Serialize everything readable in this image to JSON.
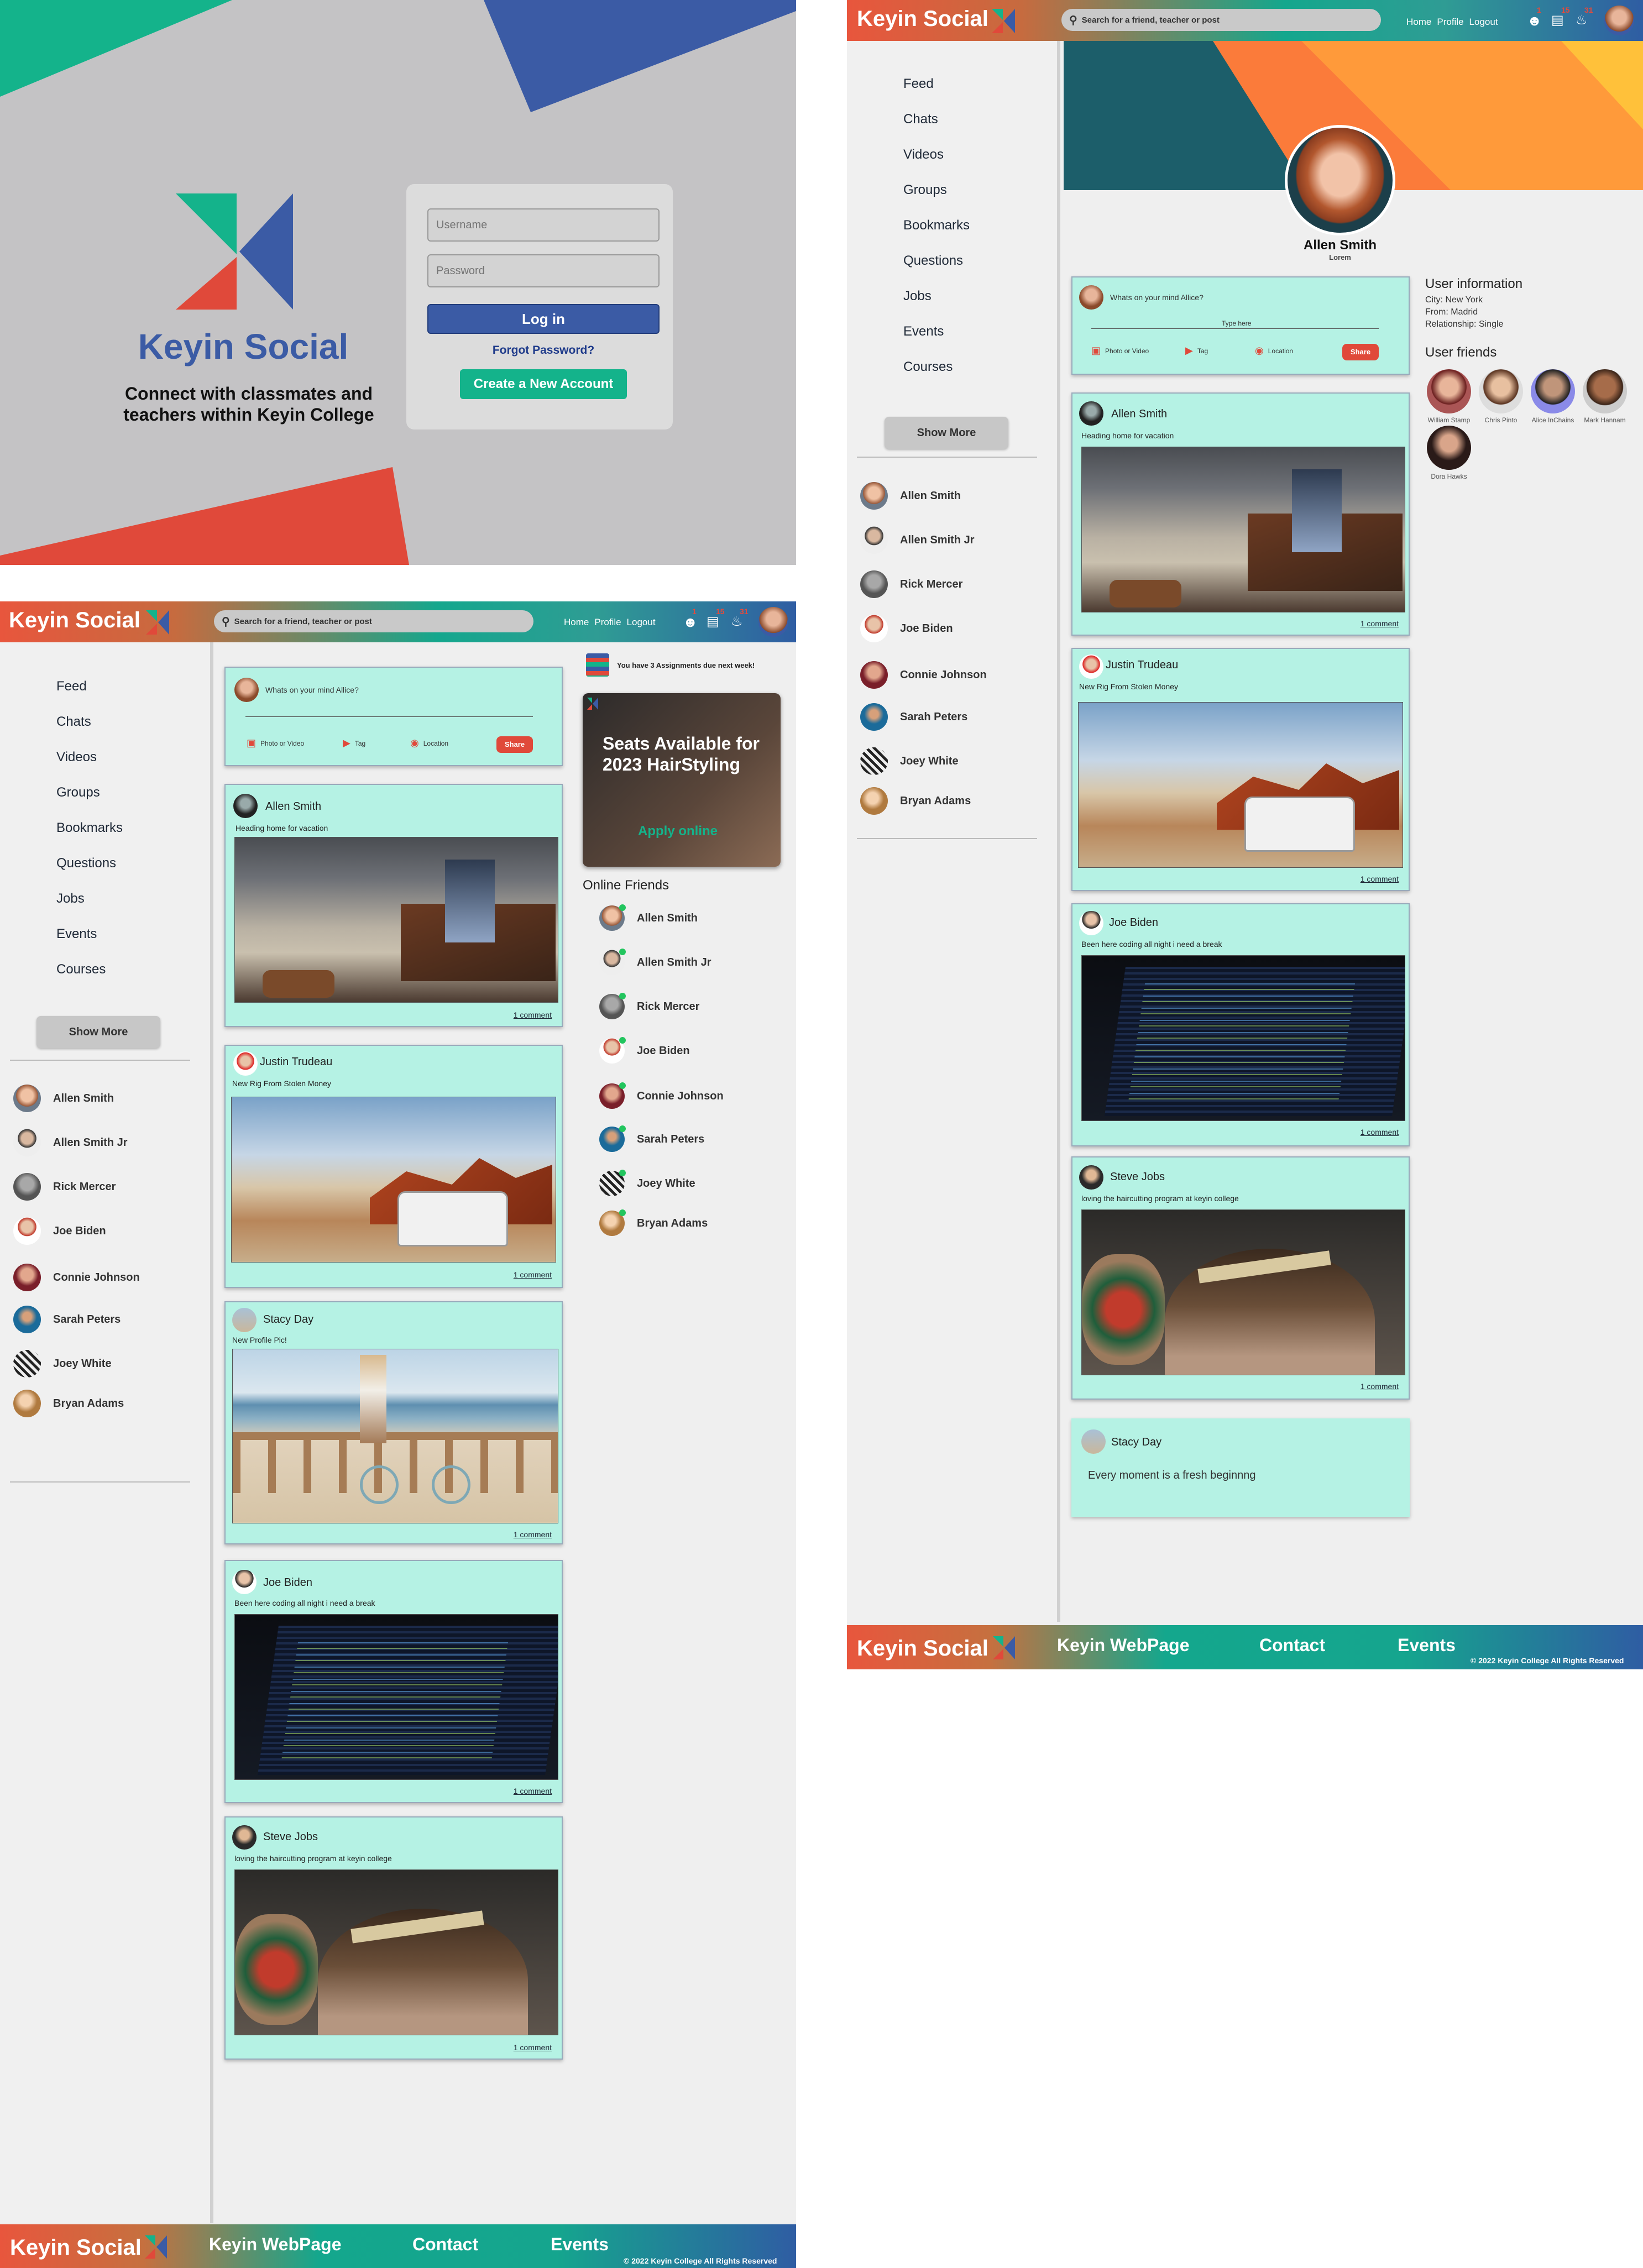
{
  "login": {
    "brand": "Keyin Social",
    "tagline": "Connect with classmates and teachers within Keyin College",
    "username_placeholder": "Username",
    "password_placeholder": "Password",
    "login_button": "Log in",
    "forgot_link": "Forgot Password?",
    "create_button": "Create a New Account"
  },
  "header": {
    "brand": "Keyin Social",
    "search_placeholder": "Search for a friend, teacher or post",
    "nav": [
      "Home",
      "Profile",
      "Logout"
    ],
    "badges": {
      "profile": "1",
      "chat": "15",
      "bell": "31"
    }
  },
  "sidebar": {
    "menu": [
      "Feed",
      "Chats",
      "Videos",
      "Groups",
      "Bookmarks",
      "Questions",
      "Jobs",
      "Events",
      "Courses"
    ],
    "show_more": "Show More",
    "friends": [
      "Allen Smith",
      "Allen Smith Jr",
      "Rick Mercer",
      "Joe Biden",
      "Connie Johnson",
      "Sarah Peters",
      "Joey White",
      "Bryan Adams"
    ]
  },
  "composer": {
    "prompt": "Whats on your mind Allice?",
    "type_here": "Type here",
    "options": [
      "Photo or Video",
      "Tag",
      "Location"
    ],
    "share": "Share"
  },
  "feed": {
    "posts": [
      {
        "author": "Allen Smith",
        "caption": "Heading home for vacation",
        "comments": "1 comment",
        "photo": "train-station"
      },
      {
        "author": "Justin Trudeau",
        "caption": "New Rig From Stolen Money",
        "comments": "1 comment",
        "photo": "suv-desert"
      },
      {
        "author": "Stacy Day",
        "caption": "New Profile Pic!",
        "comments": "1 comment",
        "photo": "beach-bike"
      },
      {
        "author": "Joe Biden",
        "caption": "Been here coding all night i need a break",
        "comments": "1 comment",
        "photo": "code-screen"
      },
      {
        "author": "Steve Jobs",
        "caption": "loving the haircutting program at keyin college",
        "comments": "1 comment",
        "photo": "haircut"
      }
    ]
  },
  "rightbar": {
    "assignments": "You have 3 Assignments due next week!",
    "ad_title": "Seats Available for 2023 HairStyling",
    "ad_cta": "Apply online",
    "online_title": "Online Friends",
    "online": [
      "Allen Smith",
      "Allen Smith Jr",
      "Rick Mercer",
      "Joe Biden",
      "Connie Johnson",
      "Sarah Peters",
      "Joey White",
      "Bryan Adams"
    ]
  },
  "profile": {
    "name": "Allen Smith",
    "sub": "Lorem",
    "info_title": "User information",
    "info": [
      "City: New York",
      "From: Madrid",
      "Relationship: Single"
    ],
    "friends_title": "User friends",
    "friends": [
      "William Stamp",
      "Chris Pinto",
      "Alice InChains",
      "Mark Hannam",
      "Dora Hawks"
    ],
    "posts": [
      {
        "author": "Allen Smith",
        "caption": "Heading home for vacation",
        "comments": "1 comment",
        "photo": "train-station"
      },
      {
        "author": "Justin Trudeau",
        "caption": "New Rig From Stolen Money",
        "comments": "1 comment",
        "photo": "suv-desert"
      },
      {
        "author": "Joe Biden",
        "caption": "Been here coding all night i need a break",
        "comments": "1 comment",
        "photo": "code-screen"
      },
      {
        "author": "Steve Jobs",
        "caption": "loving the haircutting program at keyin college",
        "comments": "1 comment",
        "photo": "haircut"
      }
    ],
    "text_post": {
      "author": "Stacy Day",
      "text": "Every moment is a fresh beginnng"
    }
  },
  "footer": {
    "brand": "Keyin Social",
    "links": [
      "Keyin WebPage",
      "Contact",
      "Events"
    ],
    "copyright": "© 2022 Keyin College All Rights Reserved"
  },
  "colors": {
    "mint_card": "#b5f2e4",
    "accent_red": "#e0493a",
    "accent_blue": "#3b5ba5",
    "accent_green": "#14b38b"
  }
}
